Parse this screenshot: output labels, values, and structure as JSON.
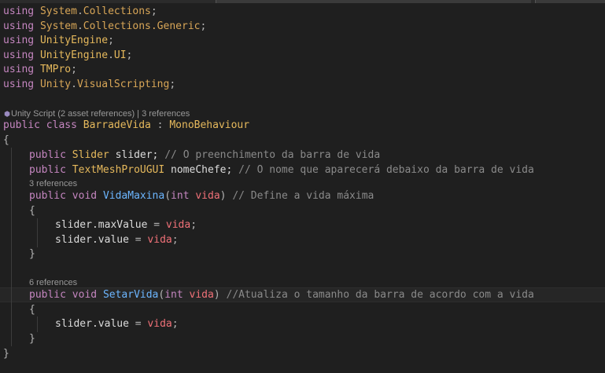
{
  "usings": [
    {
      "keyword": "using",
      "ns_a": "System",
      "dot": ".",
      "ns_b": "Collections",
      "semi": ";"
    },
    {
      "keyword": "using",
      "ns_a": "System",
      "dot": ".",
      "ns_b": "Collections.Generic",
      "semi": ";"
    },
    {
      "keyword": "using",
      "ns_a": "UnityEngine",
      "dot": "",
      "ns_b": "",
      "semi": ";"
    },
    {
      "keyword": "using",
      "ns_a": "UnityEngine",
      "dot": ".",
      "ns_b": "UI",
      "semi": ";"
    },
    {
      "keyword": "using",
      "ns_a": "TMPro",
      "dot": "",
      "ns_b": "",
      "semi": ";"
    },
    {
      "keyword": "using",
      "ns_a": "Unity",
      "dot": ".",
      "ns_b": "VisualScripting",
      "semi": ";"
    }
  ],
  "class_lens": "Unity Script (2 asset references) | 3 references",
  "class_decl": {
    "public": "public",
    "class": "class",
    "name": "BarradeVida",
    "colon": " : ",
    "base": "MonoBehaviour"
  },
  "open_brace": "{",
  "close_brace": "}",
  "fields": [
    {
      "public": "public",
      "type": "Slider",
      "name": "slider;",
      "comment": "// O preenchimento da barra de vida"
    },
    {
      "public": "public",
      "type": "TextMeshProUGUI",
      "name": "nomeChefe;",
      "comment": "// O nome que aparecerá debaixo da barra de vida"
    }
  ],
  "method1": {
    "lens": "3 references",
    "public": "public",
    "void": "void",
    "name": "VidaMaxina",
    "open": "(",
    "int": "int",
    "param": "vida",
    "close": ")",
    "comment": "// Define a vida máxima",
    "body": [
      {
        "obj": "slider",
        "prop": ".maxValue",
        "op": " = ",
        "val": "vida",
        "end": ";"
      },
      {
        "obj": "slider",
        "prop": ".value",
        "op": " = ",
        "val": "vida",
        "end": ";"
      }
    ]
  },
  "method2": {
    "lens": "6 references",
    "public": "public",
    "void": "void",
    "name": "SetarVida",
    "open": "(",
    "int": "int",
    "param": "vida",
    "close": ")",
    "comment": "//Atualiza o tamanho da barra de acordo com a vida",
    "body": [
      {
        "obj": "slider",
        "prop": ".value",
        "op": " = ",
        "val": "vida",
        "end": ";"
      }
    ]
  }
}
